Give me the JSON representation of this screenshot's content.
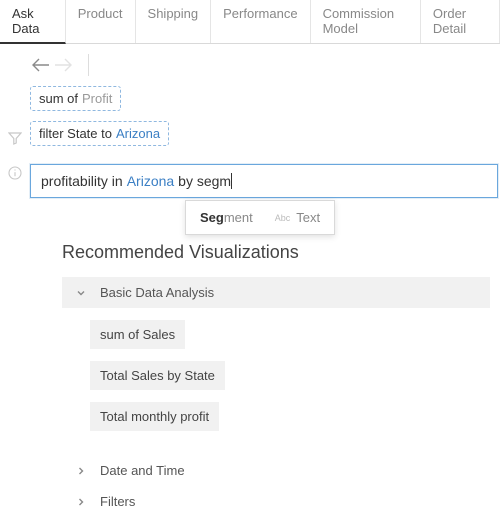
{
  "tabs": {
    "items": [
      {
        "label": "Ask Data",
        "active": true
      },
      {
        "label": "Product"
      },
      {
        "label": "Shipping"
      },
      {
        "label": "Performance"
      },
      {
        "label": "Commission Model"
      },
      {
        "label": "Order Detail"
      }
    ]
  },
  "chips": {
    "sum": {
      "prefix": "sum of",
      "field": "Profit"
    },
    "filter": {
      "prefix": "filter State to",
      "value": "Arizona"
    }
  },
  "query": {
    "pre": "profitability in",
    "highlight": "Arizona",
    "post": "by segm"
  },
  "suggest": {
    "bold": "Seg",
    "rest": "ment",
    "type_label": "Text",
    "abc": "Abc"
  },
  "recs": {
    "title": "Recommended Visualizations",
    "groups": {
      "basic": {
        "label": "Basic Data Analysis"
      },
      "datetime": {
        "label": "Date and Time"
      },
      "filters": {
        "label": "Filters"
      }
    },
    "basic_items": {
      "a": "sum of Sales",
      "b": "Total Sales by State",
      "c": "Total monthly profit"
    }
  }
}
